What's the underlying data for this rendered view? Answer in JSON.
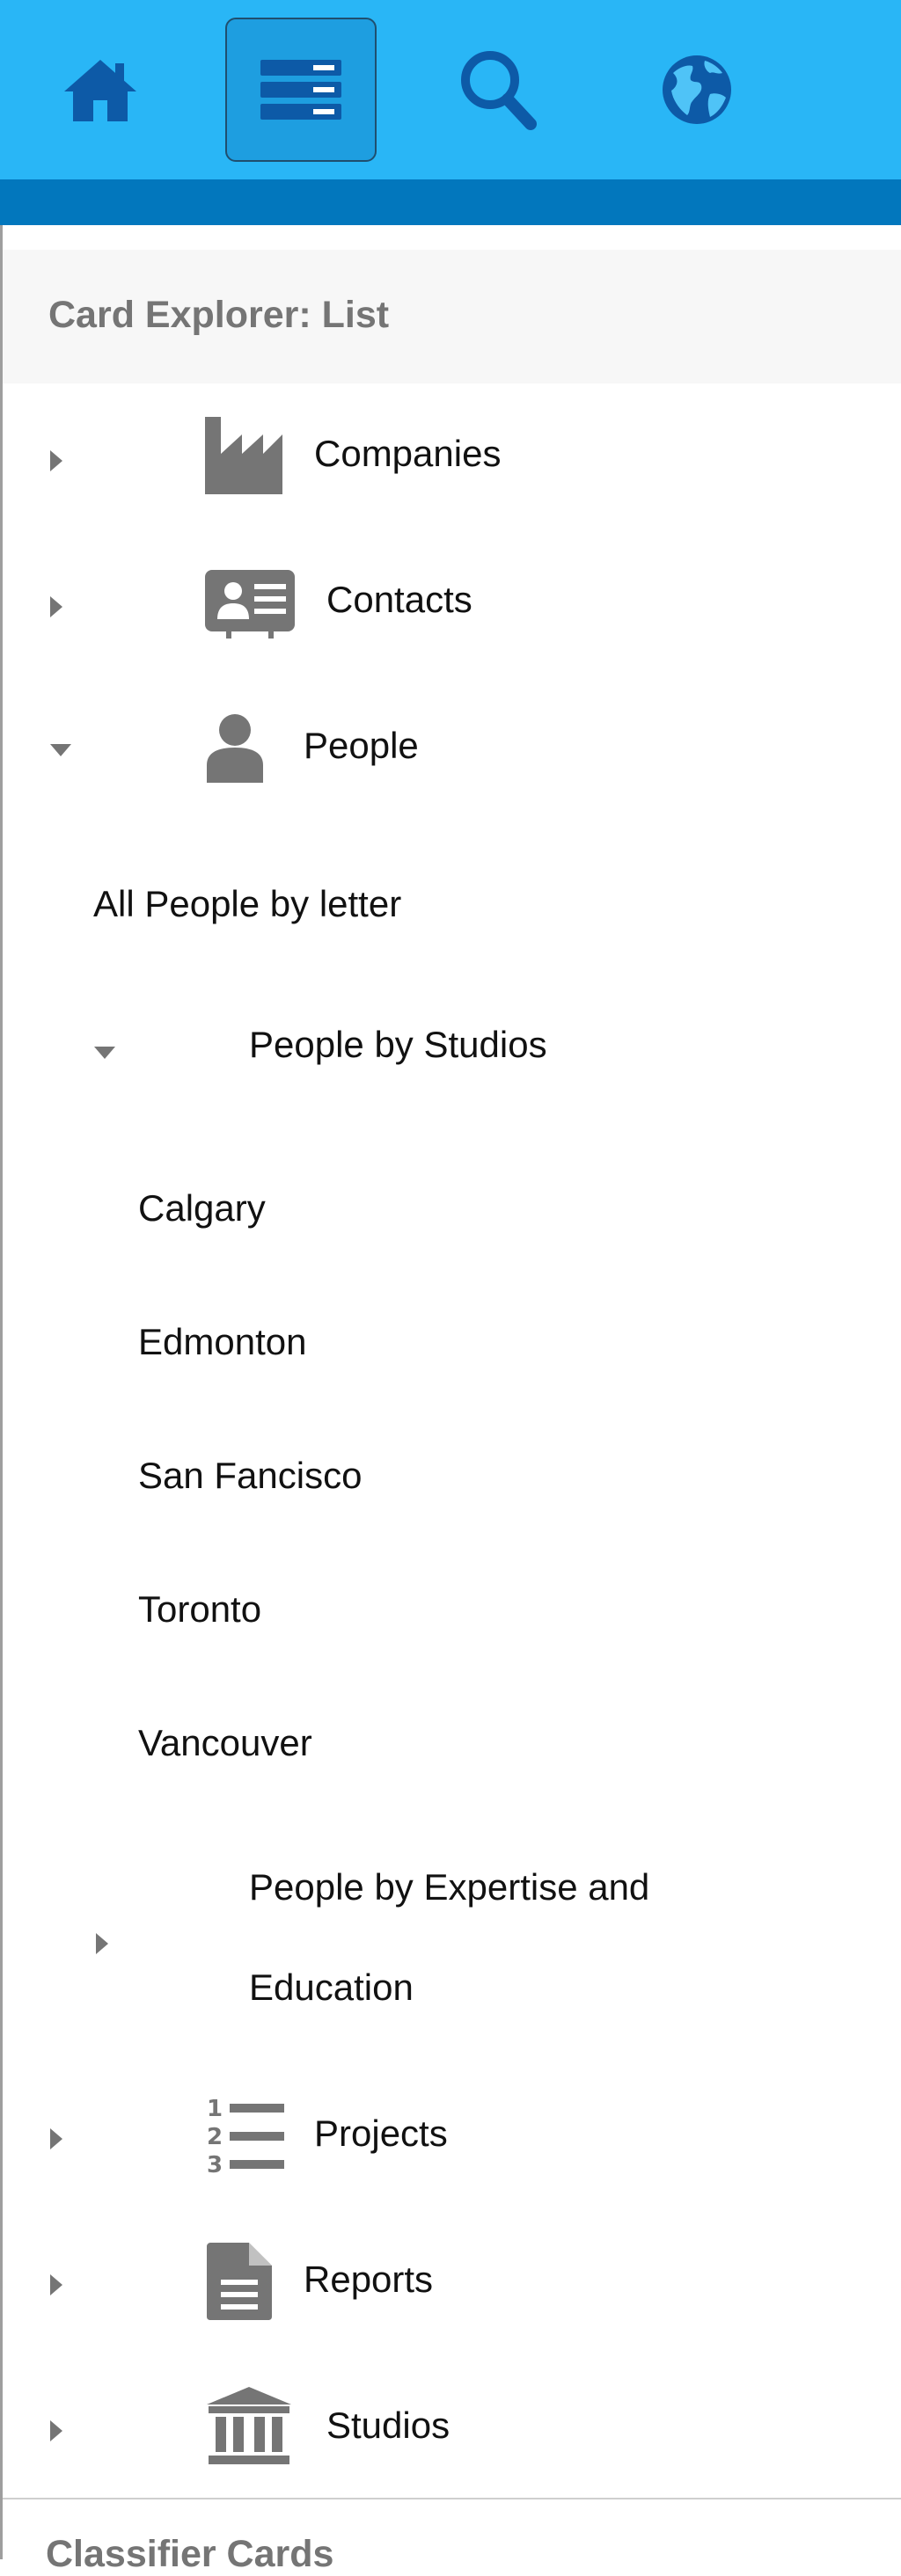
{
  "toolbar": {
    "home_icon": "home-icon",
    "list_icon": "server-list-icon",
    "search_icon": "search-icon",
    "globe_icon": "globe-icon",
    "color_bar": "#29b6f6",
    "color_strip": "#0277bd",
    "icon_color": "#0d5aa7"
  },
  "panel": {
    "title": "Card Explorer: List"
  },
  "tree": {
    "companies": "Companies",
    "contacts": "Contacts",
    "people": "People",
    "all_people": "All People by letter",
    "people_by_studios": "People by Studios",
    "studios_list": [
      "Calgary",
      "Edmonton",
      "San Fancisco",
      "Toronto",
      "Vancouver"
    ],
    "expertise_line1": "People by Expertise and",
    "expertise_line2": "Education",
    "projects": "Projects",
    "reports": "Reports",
    "studios": "Studios"
  },
  "footer": {
    "cutoff_text": "Classifier Cards"
  }
}
